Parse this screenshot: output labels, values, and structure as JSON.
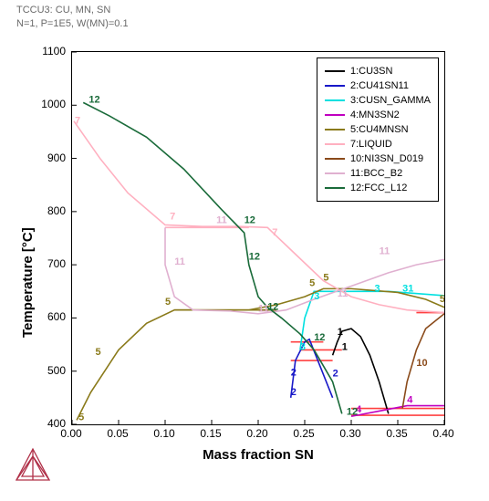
{
  "title_line1": "TCCU3: CU, MN, SN",
  "title_line2": "N=1, P=1E5, W(MN)=0.1",
  "chart_data": {
    "type": "line",
    "title": "",
    "xlabel": "Mass fraction SN",
    "ylabel": "Temperature [°C]",
    "xlim": [
      0,
      0.4
    ],
    "ylim": [
      400,
      1100
    ],
    "xticks": [
      0.0,
      0.05,
      0.1,
      0.15,
      0.2,
      0.25,
      0.3,
      0.35,
      0.4
    ],
    "yticks": [
      400,
      500,
      600,
      700,
      800,
      900,
      1000,
      1100
    ],
    "legend_position": "upper-right",
    "series": [
      {
        "name": "1:CU3SN",
        "color": "#000000",
        "points": [
          [
            0.28,
            530
          ],
          [
            0.285,
            555
          ],
          [
            0.29,
            575
          ],
          [
            0.3,
            580
          ],
          [
            0.31,
            565
          ],
          [
            0.32,
            530
          ],
          [
            0.33,
            480
          ],
          [
            0.34,
            420
          ]
        ]
      },
      {
        "name": "2:CU41SN11",
        "color": "#1818c8",
        "points": [
          [
            0.235,
            450
          ],
          [
            0.24,
            520
          ],
          [
            0.25,
            555
          ],
          [
            0.255,
            560
          ],
          [
            0.28,
            450
          ]
        ]
      },
      {
        "name": "3:CUSN_GAMMA",
        "color": "#00e0e0",
        "points": [
          [
            0.245,
            540
          ],
          [
            0.25,
            600
          ],
          [
            0.255,
            625
          ],
          [
            0.26,
            650
          ],
          [
            0.3,
            650
          ],
          [
            0.34,
            650
          ],
          [
            0.4,
            642
          ]
        ]
      },
      {
        "name": "4:MN3SN2",
        "color": "#c000c0",
        "points": [
          [
            0.3,
            415
          ],
          [
            0.33,
            425
          ],
          [
            0.36,
            435
          ],
          [
            0.4,
            435
          ]
        ]
      },
      {
        "name": "5:CU4MNSN",
        "color": "#8a7a1a",
        "points": [
          [
            0.005,
            408
          ],
          [
            0.02,
            460
          ],
          [
            0.05,
            540
          ],
          [
            0.08,
            590
          ],
          [
            0.11,
            615
          ],
          [
            0.15,
            615
          ],
          [
            0.19,
            615
          ],
          [
            0.22,
            625
          ],
          [
            0.25,
            640
          ],
          [
            0.27,
            655
          ],
          [
            0.3,
            655
          ],
          [
            0.35,
            648
          ],
          [
            0.38,
            635
          ],
          [
            0.4,
            620
          ]
        ]
      },
      {
        "name": "7:LIQUID",
        "color": "#ffb0c0",
        "points": [
          [
            0.002,
            970
          ],
          [
            0.03,
            900
          ],
          [
            0.06,
            835
          ],
          [
            0.1,
            775
          ],
          [
            0.14,
            772
          ],
          [
            0.18,
            772
          ],
          [
            0.21,
            770
          ],
          [
            0.24,
            720
          ],
          [
            0.27,
            670
          ],
          [
            0.3,
            640
          ],
          [
            0.33,
            625
          ],
          [
            0.36,
            615
          ],
          [
            0.4,
            610
          ]
        ]
      },
      {
        "name": "10:NI3SN_D019",
        "color": "#8a4a1a",
        "points": [
          [
            0.355,
            430
          ],
          [
            0.36,
            480
          ],
          [
            0.37,
            540
          ],
          [
            0.38,
            580
          ],
          [
            0.4,
            608
          ]
        ]
      },
      {
        "name": "11:BCC_B2",
        "color": "#e0b0d0",
        "points": [
          [
            0.1,
            770
          ],
          [
            0.1,
            700
          ],
          [
            0.11,
            640
          ],
          [
            0.13,
            615
          ],
          [
            0.17,
            613
          ],
          [
            0.2,
            608
          ],
          [
            0.23,
            615
          ],
          [
            0.26,
            635
          ],
          [
            0.3,
            660
          ],
          [
            0.34,
            685
          ],
          [
            0.37,
            700
          ],
          [
            0.4,
            710
          ]
        ]
      },
      {
        "name": "12:FCC_L12",
        "color": "#1a6b3a",
        "points": [
          [
            0.012,
            1005
          ],
          [
            0.04,
            980
          ],
          [
            0.08,
            940
          ],
          [
            0.12,
            880
          ],
          [
            0.16,
            805
          ],
          [
            0.185,
            760
          ],
          [
            0.19,
            700
          ],
          [
            0.2,
            640
          ],
          [
            0.21,
            620
          ],
          [
            0.225,
            600
          ],
          [
            0.245,
            570
          ],
          [
            0.26,
            540
          ],
          [
            0.28,
            480
          ],
          [
            0.29,
            420
          ]
        ]
      }
    ],
    "horizontal_segments": [
      {
        "y": 615,
        "x0": 0.11,
        "x1": 0.22,
        "color": "#8a7a1a"
      },
      {
        "y": 770,
        "x0": 0.1,
        "x1": 0.19,
        "color": "#ffb0c0"
      },
      {
        "y": 555,
        "x0": 0.235,
        "x1": 0.27,
        "color": "#ff4040"
      },
      {
        "y": 520,
        "x0": 0.235,
        "x1": 0.28,
        "color": "#ff4040"
      },
      {
        "y": 540,
        "x0": 0.245,
        "x1": 0.29,
        "color": "#ff4040"
      },
      {
        "y": 430,
        "x0": 0.3,
        "x1": 0.4,
        "color": "#ff4040"
      },
      {
        "y": 417,
        "x0": 0.3,
        "x1": 0.4,
        "color": "#ff4040"
      },
      {
        "y": 610,
        "x0": 0.37,
        "x1": 0.4,
        "color": "#ff4040"
      }
    ],
    "annotations": [
      {
        "text": "12",
        "x": 0.018,
        "y": 1005,
        "color": "#1a6b3a"
      },
      {
        "text": "7",
        "x": 0.003,
        "y": 965,
        "color": "#ffb0c0"
      },
      {
        "text": "7",
        "x": 0.105,
        "y": 785,
        "color": "#ffb0c0"
      },
      {
        "text": "11",
        "x": 0.155,
        "y": 778,
        "color": "#e0b0d0"
      },
      {
        "text": "12",
        "x": 0.185,
        "y": 778,
        "color": "#1a6b3a"
      },
      {
        "text": "7",
        "x": 0.215,
        "y": 755,
        "color": "#ffb0c0"
      },
      {
        "text": "11",
        "x": 0.11,
        "y": 700,
        "color": "#e0b0d0"
      },
      {
        "text": "12",
        "x": 0.19,
        "y": 710,
        "color": "#1a6b3a"
      },
      {
        "text": "11",
        "x": 0.33,
        "y": 720,
        "color": "#e0b0d0"
      },
      {
        "text": "5",
        "x": 0.025,
        "y": 530,
        "color": "#8a7a1a"
      },
      {
        "text": "5",
        "x": 0.1,
        "y": 625,
        "color": "#8a7a1a"
      },
      {
        "text": "11",
        "x": 0.2,
        "y": 612,
        "color": "#e0b0d0"
      },
      {
        "text": "5",
        "x": 0.255,
        "y": 660,
        "color": "#8a7a1a"
      },
      {
        "text": "5",
        "x": 0.27,
        "y": 670,
        "color": "#8a7a1a"
      },
      {
        "text": "3",
        "x": 0.26,
        "y": 635,
        "color": "#00e0e0"
      },
      {
        "text": "3",
        "x": 0.325,
        "y": 650,
        "color": "#00e0e0"
      },
      {
        "text": "11",
        "x": 0.285,
        "y": 640,
        "color": "#e0b0d0"
      },
      {
        "text": "31",
        "x": 0.355,
        "y": 650,
        "color": "#00e0e0"
      },
      {
        "text": "5",
        "x": 0.395,
        "y": 630,
        "color": "#8a7a1a"
      },
      {
        "text": "12",
        "x": 0.21,
        "y": 615,
        "color": "#1a6b3a"
      },
      {
        "text": "12",
        "x": 0.26,
        "y": 558,
        "color": "#1a6b3a"
      },
      {
        "text": "1",
        "x": 0.285,
        "y": 568,
        "color": "#000"
      },
      {
        "text": "1",
        "x": 0.29,
        "y": 540,
        "color": "#000"
      },
      {
        "text": "2",
        "x": 0.28,
        "y": 490,
        "color": "#1818c8"
      },
      {
        "text": "3",
        "x": 0.245,
        "y": 540,
        "color": "#00e0e0"
      },
      {
        "text": "2",
        "x": 0.235,
        "y": 492,
        "color": "#1818c8"
      },
      {
        "text": "2",
        "x": 0.235,
        "y": 455,
        "color": "#1818c8"
      },
      {
        "text": "10",
        "x": 0.37,
        "y": 510,
        "color": "#8a4a1a"
      },
      {
        "text": "4",
        "x": 0.305,
        "y": 422,
        "color": "#c000c0"
      },
      {
        "text": "4",
        "x": 0.36,
        "y": 440,
        "color": "#c000c0"
      },
      {
        "text": "12",
        "x": 0.295,
        "y": 418,
        "color": "#1a6b3a"
      },
      {
        "text": "5",
        "x": 0.007,
        "y": 408,
        "color": "#8a7a1a"
      }
    ]
  }
}
